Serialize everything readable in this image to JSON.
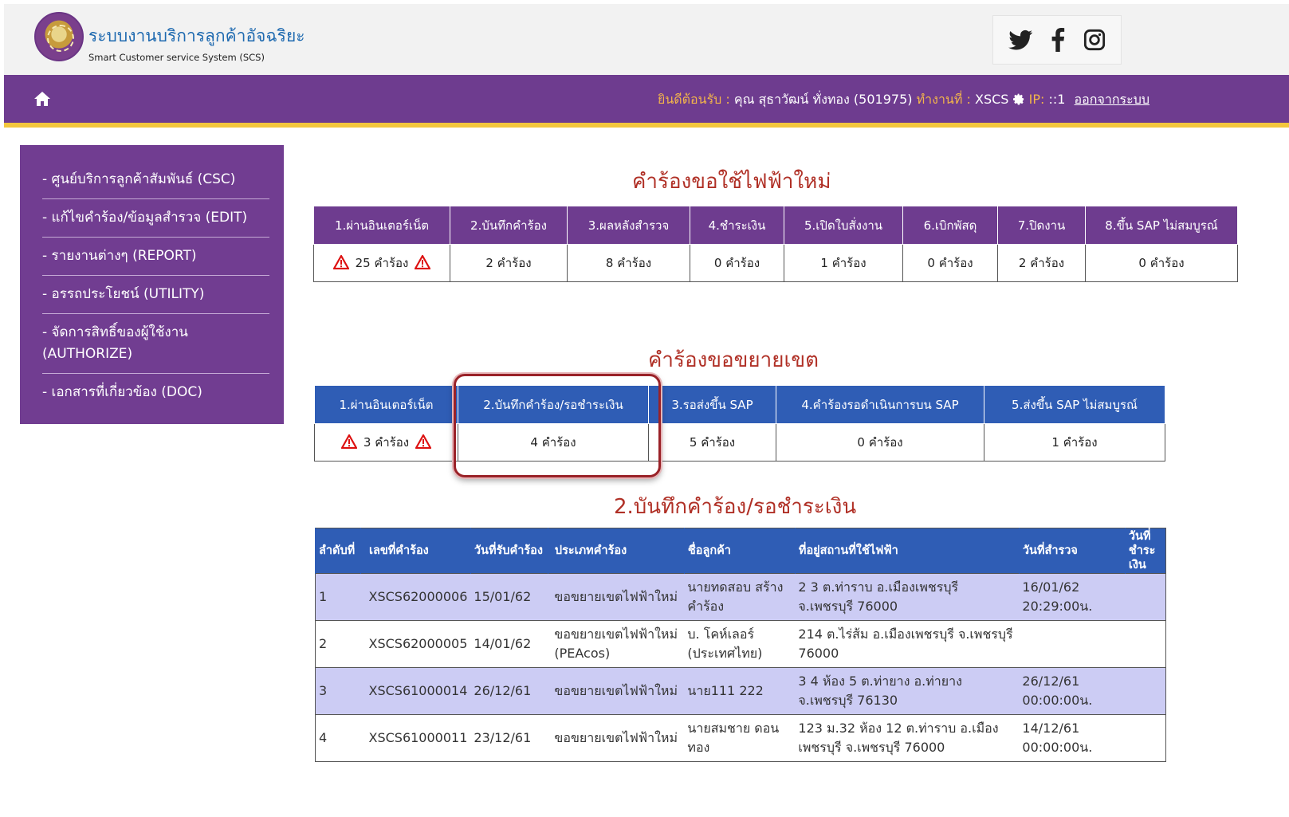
{
  "header": {
    "title": "ระบบงานบริการลูกค้าอัจฉริยะ",
    "subtitle": "Smart Customer service System (SCS)",
    "social": [
      "twitter-icon",
      "facebook-icon",
      "instagram-icon"
    ]
  },
  "navbar": {
    "welcome_label": "ยินดีต้อนรับ :",
    "user": "คุณ สุธาวัฒน์ ทั่งทอง (501975)",
    "workplace_label": "ทำงานที่ :",
    "workplace": "XSCS",
    "ip_label": "IP:",
    "ip": "::1",
    "logout": "ออกจากระบบ"
  },
  "sidebar": {
    "items": [
      {
        "label": "- ศูนย์บริการลูกค้าสัมพันธ์ (CSC)"
      },
      {
        "label": "- แก้ไขคำร้อง/ข้อมูลสำรวจ (EDIT)"
      },
      {
        "label": "- รายงานต่างๆ (REPORT)"
      },
      {
        "label": "- อรรถประโยชน์ (UTILITY)"
      },
      {
        "label": "- จัดการสิทธิ์ของผู้ใช้งาน (AUTHORIZE)"
      },
      {
        "label": "- เอกสารที่เกี่ยวข้อง (DOC)"
      }
    ]
  },
  "new_electricity": {
    "title": "คำร้องขอใช้ไฟฟ้าใหม่",
    "headers": [
      "1.ผ่านอินเตอร์เน็ต",
      "2.บันทึกคำร้อง",
      "3.ผลหลังสำรวจ",
      "4.ชำระเงิน",
      "5.เปิดใบสั่งงาน",
      "6.เบิกพัสดุ",
      "7.ปิดงาน",
      "8.ขึ้น SAP ไม่สมบูรณ์"
    ],
    "values": [
      "25 คำร้อง",
      "2 คำร้อง",
      "8 คำร้อง",
      "0 คำร้อง",
      "1 คำร้อง",
      "0 คำร้อง",
      "2 คำร้อง",
      "0 คำร้อง"
    ]
  },
  "extension": {
    "title": "คำร้องขอขยายเขต",
    "headers": [
      "1.ผ่านอินเตอร์เน็ต",
      "2.บันทึกคำร้อง/รอชำระเงิน",
      "3.รอส่งขึ้น SAP",
      "4.คำร้องรอดำเนินการบน SAP",
      "5.ส่งขึ้น SAP ไม่สมบูรณ์"
    ],
    "values": [
      "3 คำร้อง",
      "4 คำร้อง",
      "5 คำร้อง",
      "0 คำร้อง",
      "1 คำร้อง"
    ]
  },
  "detail": {
    "title": "2.บันทึกคำร้อง/รอชำระเงิน",
    "columns": [
      "ลำดับที่",
      "เลขที่คำร้อง",
      "วันที่รับคำร้อง",
      "ประเภทคำร้อง",
      "ชื่อลูกค้า",
      "ที่อยู่สถานที่ใช้ไฟฟ้า",
      "วันที่สำรวจ",
      "วันที่ชำระเงิน"
    ],
    "rows": [
      {
        "no": "1",
        "req": "XSCS62000006",
        "date": "15/01/62",
        "type": "ขอขยายเขตไฟฟ้าใหม่",
        "name": "นายทดสอบ สร้างคำร้อง",
        "addr": "2 3 ต.ท่าราบ อ.เมืองเพชรบุรี จ.เพชรบุรี 76000",
        "survey": "16/01/62 20:29:00น.",
        "paid": ""
      },
      {
        "no": "2",
        "req": "XSCS62000005",
        "date": "14/01/62",
        "type": "ขอขยายเขตไฟฟ้าใหม่ (PEAcos)",
        "name": "บ. โคห์เลอร์ (ประเทศไทย)",
        "addr": "214 ต.ไร่ส้ม อ.เมืองเพชรบุรี จ.เพชรบุรี 76000",
        "survey": "",
        "paid": ""
      },
      {
        "no": "3",
        "req": "XSCS61000014",
        "date": "26/12/61",
        "type": "ขอขยายเขตไฟฟ้าใหม่",
        "name": "นาย111 222",
        "addr": "3 4 ห้อง 5 ต.ท่ายาง อ.ท่ายาง จ.เพชรบุรี 76130",
        "survey": "26/12/61 00:00:00น.",
        "paid": ""
      },
      {
        "no": "4",
        "req": "XSCS61000011",
        "date": "23/12/61",
        "type": "ขอขยายเขตไฟฟ้าใหม่",
        "name": "นายสมชาย ดอนทอง",
        "addr": "123 ม.32 ห้อง 12 ต.ท่าราบ อ.เมืองเพชรบุรี จ.เพชรบุรี 76000",
        "survey": "14/12/61 00:00:00น.",
        "paid": ""
      }
    ]
  },
  "colors": {
    "purple": "#6e3c8f",
    "blue": "#2f5db5",
    "gold": "#f3c63d",
    "title_red": "#b03026",
    "row_highlight": "#ccccf4"
  }
}
